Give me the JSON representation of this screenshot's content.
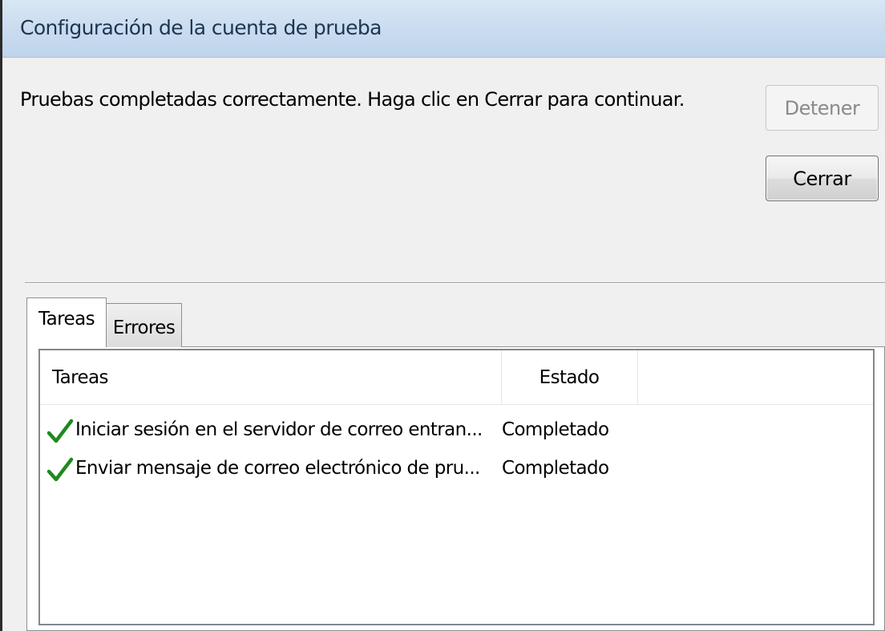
{
  "window": {
    "title": "Configuración de la cuenta de prueba"
  },
  "message": "Pruebas completadas correctamente. Haga clic en Cerrar para continuar.",
  "buttons": {
    "stop_label": "Detener",
    "close_label": "Cerrar"
  },
  "tabs": [
    {
      "label": "Tareas",
      "selected": true
    },
    {
      "label": "Errores",
      "selected": false
    }
  ],
  "list": {
    "columns": [
      "Tareas",
      "Estado"
    ],
    "rows": [
      {
        "task": "Iniciar sesión en el servidor de correo entran...",
        "status": "Completado",
        "icon": "check-icon"
      },
      {
        "task": "Enviar mensaje de correo electrónico de pru...",
        "status": "Completado",
        "icon": "check-icon"
      }
    ]
  },
  "colors": {
    "check_green": "#1d8a1d",
    "titlebar": "#cadcef"
  }
}
